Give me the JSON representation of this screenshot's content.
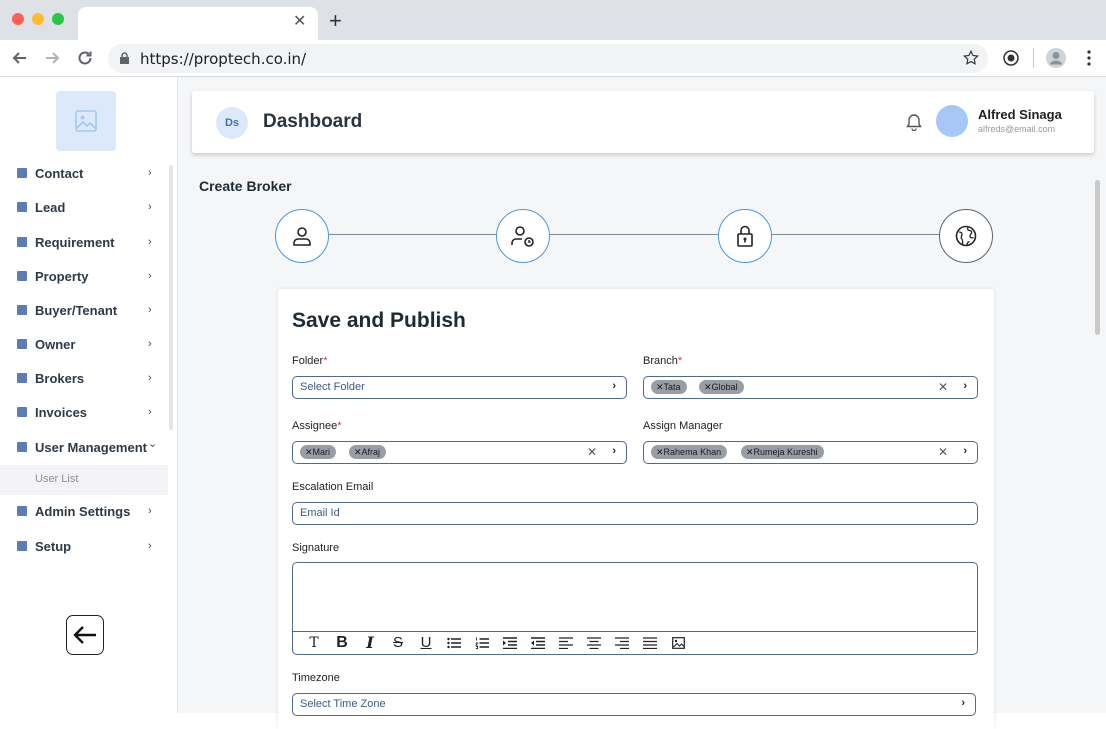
{
  "browser": {
    "url": "https://proptech.co.in/",
    "icons": [
      "back-icon",
      "forward-icon",
      "reload-icon",
      "lock-icon",
      "star-icon",
      "extension-icon",
      "profile-icon",
      "menu-icon"
    ]
  },
  "sidebar": {
    "items": [
      {
        "label": "Contact",
        "chevron": "›"
      },
      {
        "label": "Lead",
        "chevron": "›"
      },
      {
        "label": "Requirement",
        "chevron": "›"
      },
      {
        "label": "Property",
        "chevron": "›"
      },
      {
        "label": "Buyer/Tenant",
        "chevron": "›"
      },
      {
        "label": "Owner",
        "chevron": "›"
      },
      {
        "label": "Brokers",
        "chevron": "›"
      },
      {
        "label": "Invoices",
        "chevron": "›"
      },
      {
        "label": "User Management",
        "chevron": "⌄"
      },
      {
        "label": "Admin Settings",
        "chevron": "›"
      },
      {
        "label": "Setup",
        "chevron": "›"
      }
    ],
    "sub_item": "User List"
  },
  "header": {
    "initials": "Ds",
    "title": "Dashboard",
    "user_name": "Alfred Sinaga",
    "user_email": "alfreds@email.com"
  },
  "page": {
    "section_title": "Create Broker",
    "card_title": "Save and Publish"
  },
  "form": {
    "folder": {
      "label": "Folder",
      "required": "*",
      "placeholder": "Select Folder"
    },
    "branch": {
      "label": "Branch",
      "required": "*",
      "chips": [
        "Tata",
        "Global"
      ]
    },
    "assignee": {
      "label": "Assignee",
      "required": "*",
      "chips": [
        "Mari",
        "Afraj"
      ]
    },
    "assign_manager": {
      "label": "Assign Manager",
      "chips": [
        "Rahema Khan",
        "Rumeja Kureshi"
      ]
    },
    "escalation_email": {
      "label": "Escalation Email",
      "placeholder": "Email Id"
    },
    "signature": {
      "label": "Signature"
    },
    "timezone": {
      "label": "Timezone",
      "placeholder": "Select Time Zone"
    }
  },
  "chip_x": "✕",
  "clear_x": "✕",
  "chevron": "›"
}
